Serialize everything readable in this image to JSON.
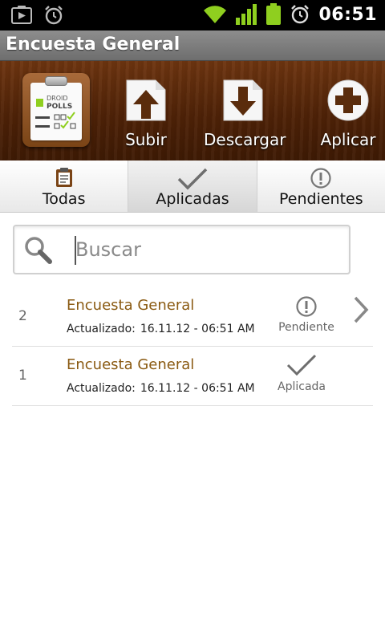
{
  "status_bar": {
    "time": "06:51",
    "icons": [
      "play-store-icon",
      "alarm-icon",
      "wifi-icon",
      "signal-icon",
      "battery-icon",
      "alarm-clock-icon"
    ]
  },
  "title_bar": {
    "title": "Encuesta General"
  },
  "toolbar": {
    "logo_text_1": "DROID",
    "logo_text_2": "POLLS",
    "buttons": [
      {
        "label": "Subir",
        "icon": "upload-icon"
      },
      {
        "label": "Descargar",
        "icon": "download-icon"
      },
      {
        "label": "Aplicar",
        "icon": "add-icon"
      }
    ]
  },
  "tabs": [
    {
      "label": "Todas",
      "icon": "clipboard-icon",
      "active": false
    },
    {
      "label": "Aplicadas",
      "icon": "checkmark-icon",
      "active": true
    },
    {
      "label": "Pendientes",
      "icon": "exclamation-icon",
      "active": false
    }
  ],
  "search": {
    "placeholder": "Buscar",
    "value": ""
  },
  "list": [
    {
      "number": "2",
      "title": "Encuesta General",
      "updated_label": "Actualizado:",
      "updated_value": "16.11.12 - 06:51 AM",
      "status": "Pendiente",
      "status_icon": "exclamation-icon"
    },
    {
      "number": "1",
      "title": "Encuesta General",
      "updated_label": "Actualizado:",
      "updated_value": "16.11.12 - 06:51 AM",
      "status": "Aplicada",
      "status_icon": "checkmark-icon"
    }
  ],
  "colors": {
    "wood": "#5a280a",
    "title_bar": "#7d7d7d",
    "item_title": "#8a5a12",
    "wifi_green": "#8fcf1f"
  }
}
